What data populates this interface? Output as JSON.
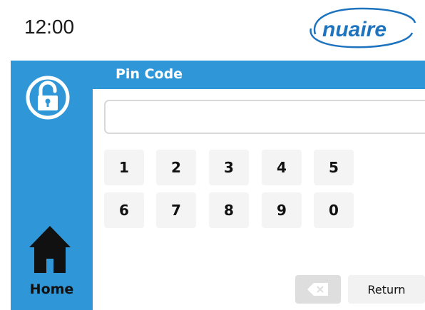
{
  "status": {
    "time": "12:00"
  },
  "brand": {
    "logo_text": "nuaire",
    "color": "#1e73be"
  },
  "colors": {
    "accent": "#2f96d8",
    "key_background": "#f4f4f4"
  },
  "sidebar": {
    "lock_icon": "unlocked-padlock-icon",
    "home_icon": "house-icon",
    "home_label": "Home"
  },
  "pin_panel": {
    "title": "Pin Code",
    "input_value": "",
    "keypad_row1": [
      "1",
      "2",
      "3",
      "4",
      "5"
    ],
    "keypad_row2": [
      "6",
      "7",
      "8",
      "9",
      "0"
    ],
    "backspace_icon": "backspace-icon",
    "return_label": "Return"
  }
}
